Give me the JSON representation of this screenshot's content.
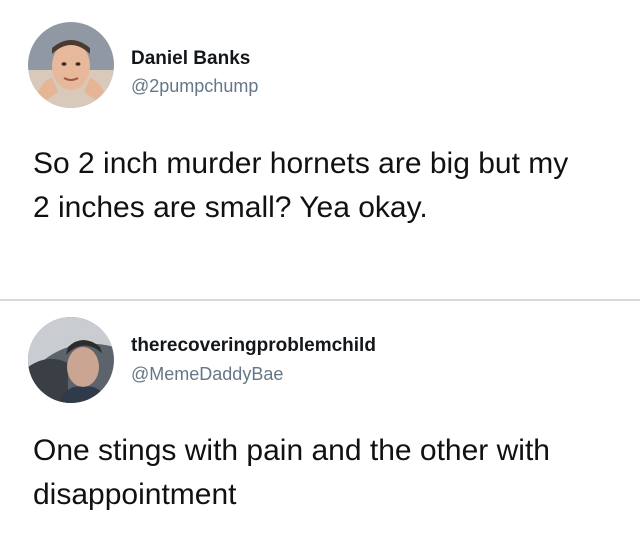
{
  "tweets": [
    {
      "author_name": "Daniel Banks",
      "author_handle": "@2pumpchump",
      "text": "So 2 inch murder hornets are big but my 2 inches are small? Yea okay."
    },
    {
      "author_name": "therecoveringproblemchild",
      "author_handle": "@MemeDaddyBae",
      "text": "One stings with pain and the other with disappointment"
    }
  ],
  "colors": {
    "background": "#ffffff",
    "name": "#14171a",
    "handle": "#657786",
    "divider": "#d9d9d9"
  }
}
